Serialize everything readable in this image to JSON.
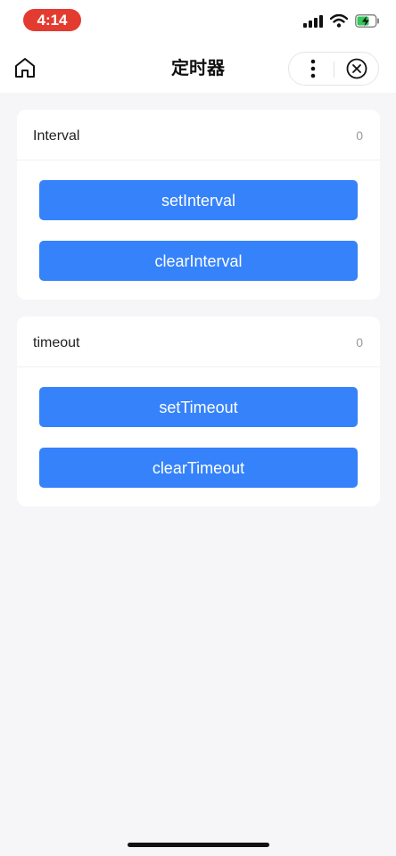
{
  "status_bar": {
    "time": "4:14",
    "icons": [
      "signal-icon",
      "wifi-icon",
      "battery-charging-icon"
    ],
    "time_pill_color": "#e33b30",
    "battery_color": "#34c759"
  },
  "nav": {
    "title": "定时器",
    "icons": [
      "home-icon",
      "more-icon",
      "close-icon"
    ]
  },
  "sections": {
    "interval": {
      "title": "Interval",
      "count": "0",
      "buttons": [
        "setInterval",
        "clearInterval"
      ]
    },
    "timeout": {
      "title": "timeout",
      "count": "0",
      "buttons": [
        "setTimeout",
        "clearTimeout"
      ]
    }
  },
  "colors": {
    "button_bg": "#3582fa",
    "page_bg": "#f6f5f7"
  }
}
